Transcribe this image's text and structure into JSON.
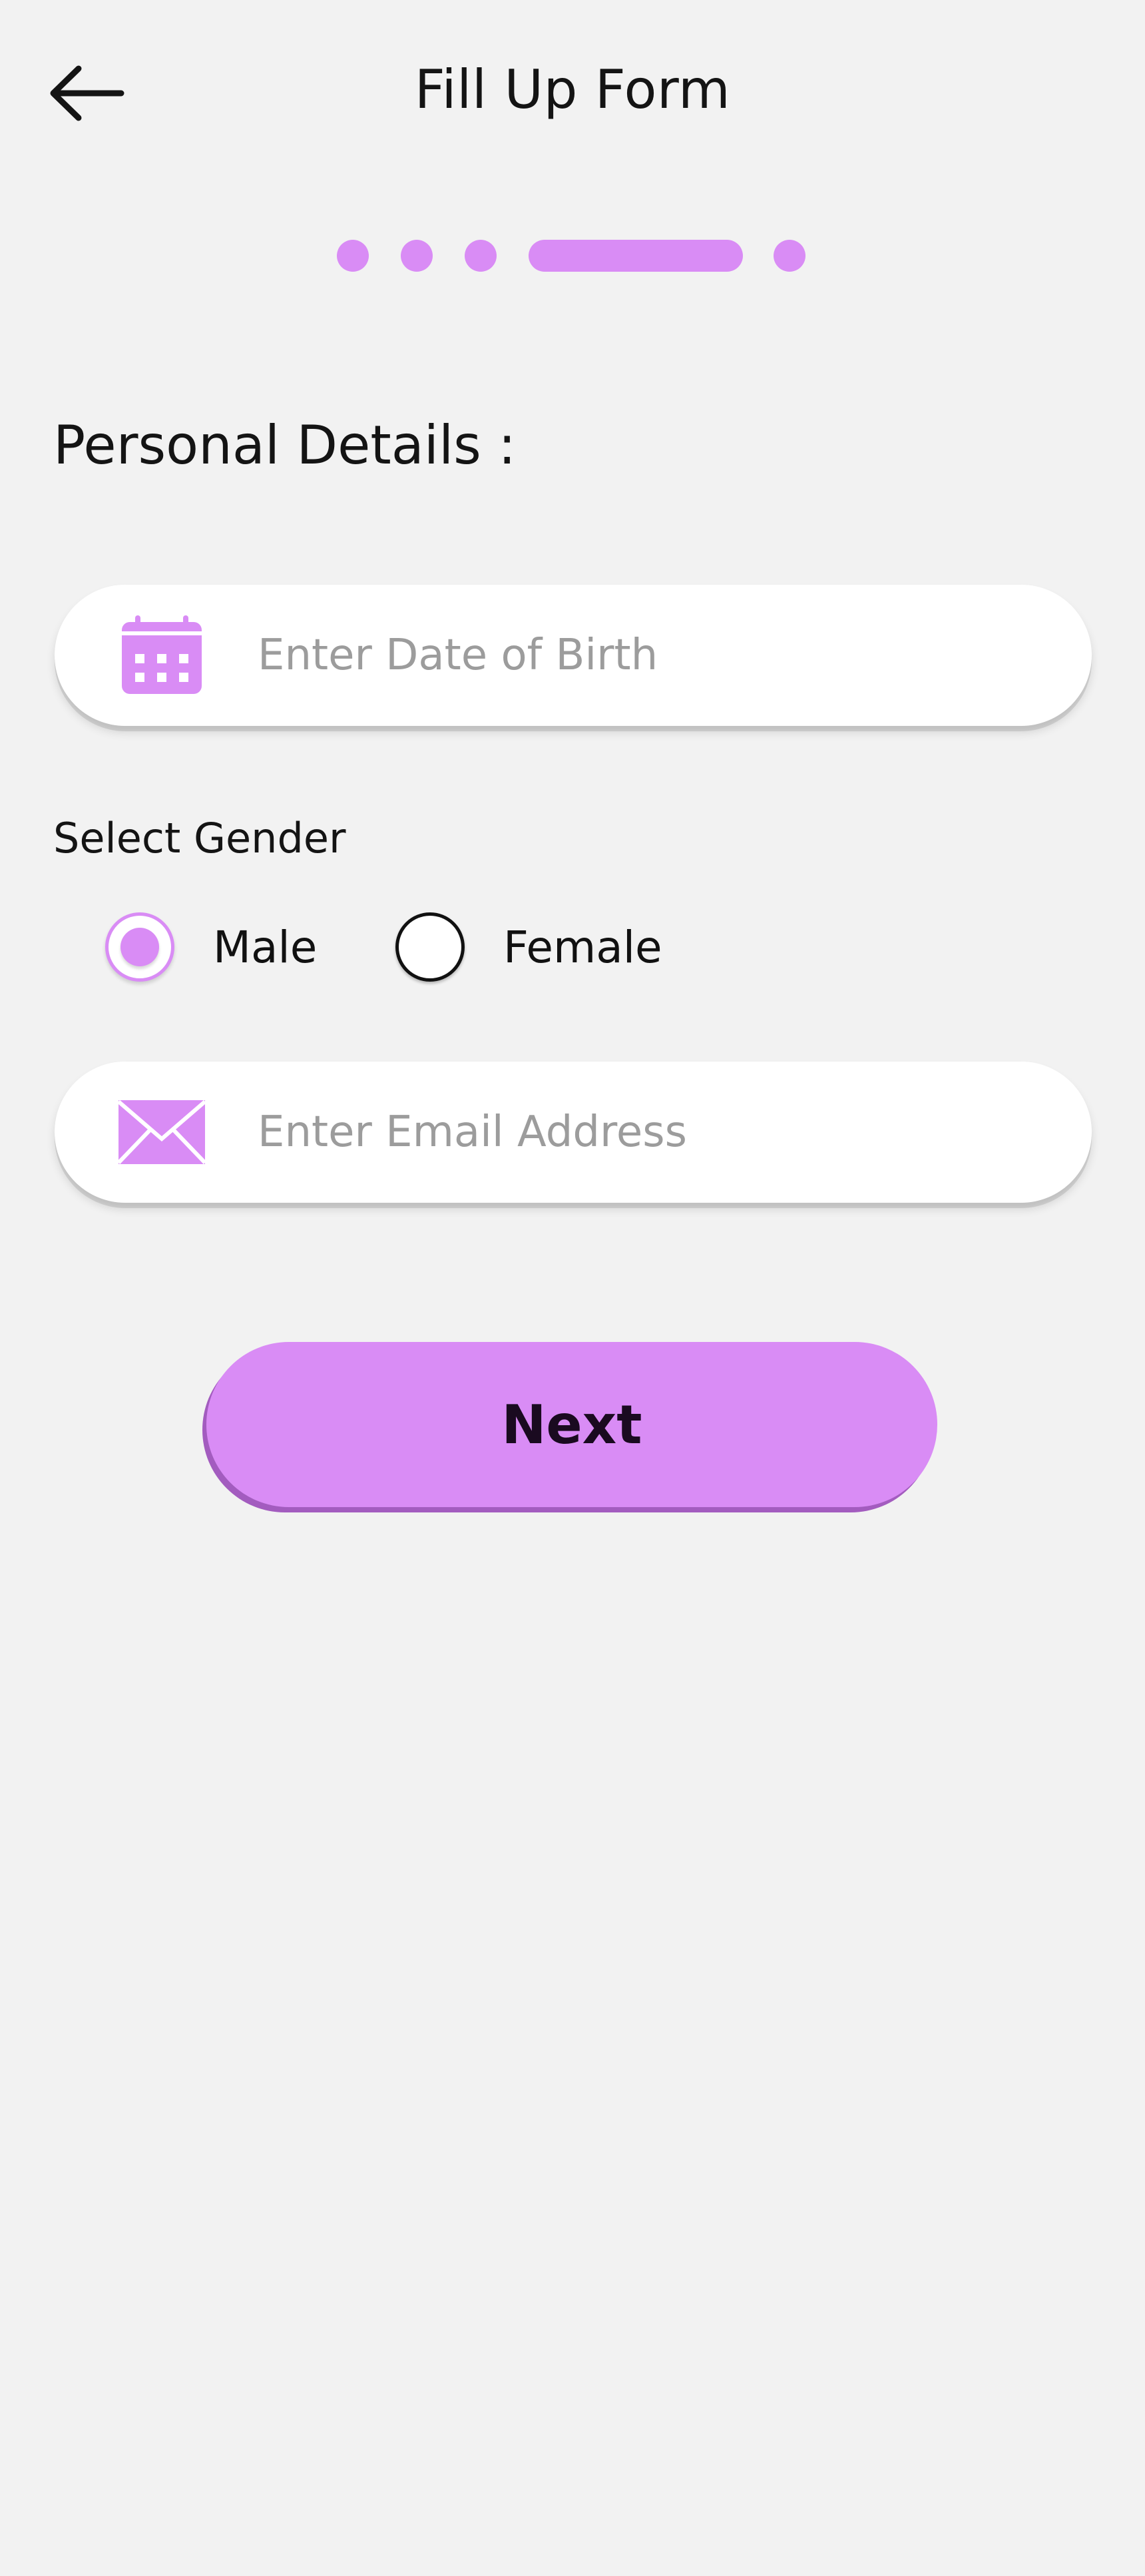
{
  "header": {
    "title": "Fill Up Form",
    "back_icon": "arrow-left-icon"
  },
  "stepper": {
    "total_steps": 5,
    "current_step": 4,
    "color": "#d98cf5"
  },
  "form": {
    "section_title": "Personal Details :",
    "dob": {
      "icon": "calendar-icon",
      "placeholder": "Enter Date of Birth",
      "value": ""
    },
    "gender": {
      "label": "Select Gender",
      "options": [
        {
          "label": "Male",
          "selected": true
        },
        {
          "label": "Female",
          "selected": false
        }
      ]
    },
    "email": {
      "icon": "mail-icon",
      "placeholder": "Enter Email Address",
      "value": ""
    },
    "next_label": "Next"
  },
  "colors": {
    "accent": "#d98cf5",
    "background": "#f2f2f2",
    "button_shadow": "#a35cbf"
  }
}
